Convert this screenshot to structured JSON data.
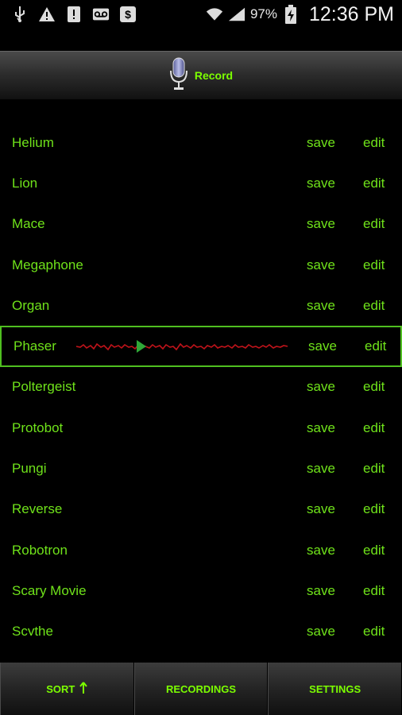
{
  "status_bar": {
    "battery": "97%",
    "time": "12:36 PM",
    "icons": [
      "usb-icon",
      "warning-icon",
      "sim-alert-icon",
      "voicemail-icon",
      "dollar-app-icon",
      "wifi-icon",
      "signal-icon",
      "battery-charging-icon"
    ]
  },
  "header": {
    "record_label": "Record"
  },
  "effects": [
    {
      "name": "Helium"
    },
    {
      "name": "Lion"
    },
    {
      "name": "Mace"
    },
    {
      "name": "Megaphone"
    },
    {
      "name": "Organ"
    },
    {
      "name": "Phaser",
      "selected": true
    },
    {
      "name": "Poltergeist"
    },
    {
      "name": "Protobot"
    },
    {
      "name": "Pungi"
    },
    {
      "name": "Reverse"
    },
    {
      "name": "Robotron"
    },
    {
      "name": "Scary Movie"
    },
    {
      "name": "Scythe"
    }
  ],
  "row_actions": {
    "save": "save",
    "edit": "edit"
  },
  "tabs": {
    "sort": "SORT",
    "recordings": "RECORDINGS",
    "settings": "SETTINGS"
  },
  "colors": {
    "accent": "#7cff00",
    "text": "#6fe21a",
    "waveform": "#c0131a",
    "play": "#2fa838"
  }
}
